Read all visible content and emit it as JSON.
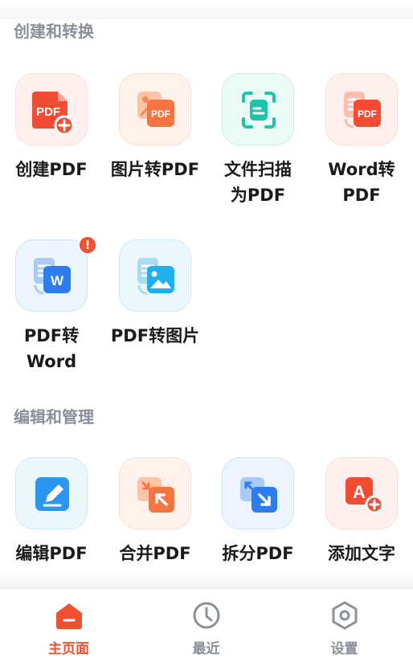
{
  "sections": [
    {
      "title": "创建和转换",
      "tools": [
        {
          "label": "创建PDF",
          "icon": "create-pdf-icon"
        },
        {
          "label": "图片转PDF",
          "icon": "image-to-pdf-icon"
        },
        {
          "label": "文件扫描为PDF",
          "icon": "scan-icon"
        },
        {
          "label": "Word转PDF",
          "icon": "word-to-pdf-icon"
        },
        {
          "label": "PDF转Word",
          "icon": "pdf-to-word-icon",
          "badge": "!"
        },
        {
          "label": "PDF转图片",
          "icon": "pdf-to-image-icon"
        }
      ]
    },
    {
      "title": "编辑和管理",
      "tools": [
        {
          "label": "编辑PDF",
          "icon": "edit-icon"
        },
        {
          "label": "合并PDF",
          "icon": "merge-icon"
        },
        {
          "label": "拆分PDF",
          "icon": "split-icon"
        },
        {
          "label": "添加文字",
          "icon": "add-text-icon"
        }
      ]
    }
  ],
  "tabbar": {
    "items": [
      {
        "label": "主页面",
        "icon": "home-icon",
        "active": true
      },
      {
        "label": "最近",
        "icon": "clock-icon",
        "active": false
      },
      {
        "label": "设置",
        "icon": "settings-icon",
        "active": false
      }
    ]
  },
  "colors": {
    "accent": "#f0502d",
    "section_title": "#8a8f99",
    "inactive_tab": "#8a8f99",
    "pdf_red": "#f24c32",
    "teal": "#1fc4ad",
    "blue": "#2b7df0"
  }
}
